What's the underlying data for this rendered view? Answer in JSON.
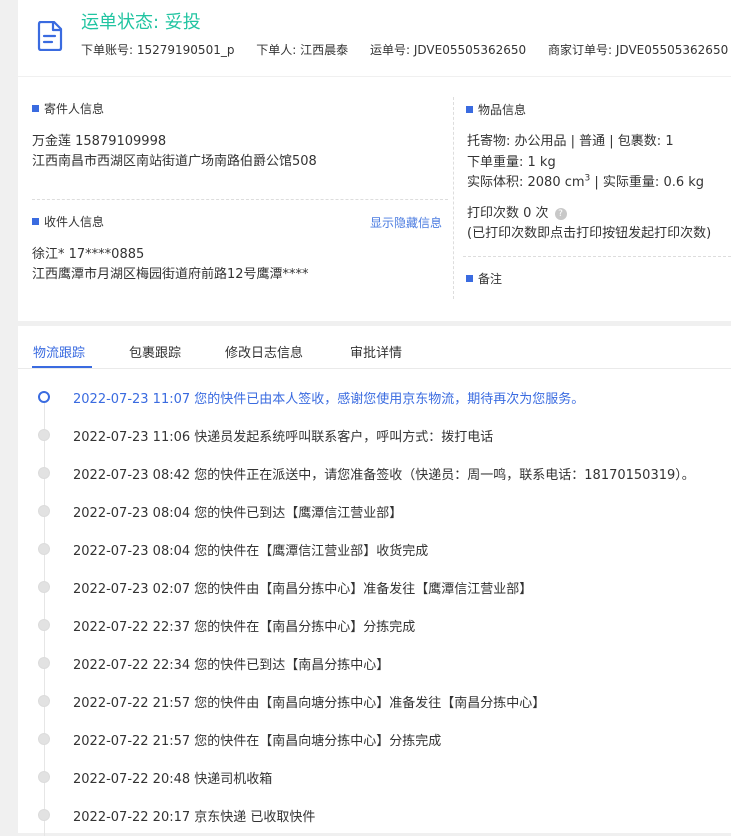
{
  "header": {
    "status": "运单状态: 妥投",
    "order_account": "下单账号: 15279190501_p",
    "orderer": "下单人: 江西晨泰",
    "waybill_no": "运单号: JDVE05505362650",
    "merchant_order_no": "商家订单号: JDVE05505362650",
    "status_color": "#21c4a1"
  },
  "sender": {
    "title": "寄件人信息",
    "name_phone": "万金莲   15879109998",
    "address": "江西南昌市西湖区南站街道广场南路伯爵公馆508"
  },
  "receiver": {
    "title": "收件人信息",
    "toggle_link": "显示隐藏信息",
    "name_phone": "徐江*   17****0885",
    "address": "江西鹰潭市月湖区梅园街道府前路12号鹰潭****"
  },
  "goods": {
    "title": "物品信息",
    "line1": "托寄物:  办公用品 | 普通  |  包裹数:  1",
    "line2": "下单重量:  1 kg",
    "volume_prefix": "实际体积:    2080 cm",
    "volume_sup": "3",
    "volume_suffix": "  |  实际重量:   0.6 kg",
    "print_count": "打印次数    0 次",
    "print_note": "(已打印次数即点击打印按钮发起打印次数)"
  },
  "remark": {
    "title": "备注"
  },
  "tabs": [
    "物流跟踪",
    "包裹跟踪",
    "修改日志信息",
    "审批详情"
  ],
  "timeline": [
    "2022-07-23 11:07 您的快件已由本人签收，感谢您使用京东物流，期待再次为您服务。",
    "2022-07-23 11:06 快递员发起系统呼叫联系客户，呼叫方式：拨打电话",
    "2022-07-23 08:42 您的快件正在派送中，请您准备签收（快递员：周一鸣，联系电话：18170150319）。",
    "2022-07-23 08:04 您的快件已到达【鹰潭信江营业部】",
    "2022-07-23 08:04 您的快件在【鹰潭信江营业部】收货完成",
    "2022-07-23 02:07 您的快件由【南昌分拣中心】准备发往【鹰潭信江营业部】",
    "2022-07-22 22:37 您的快件在【南昌分拣中心】分拣完成",
    "2022-07-22 22:34 您的快件已到达【南昌分拣中心】",
    "2022-07-22 21:57 您的快件由【南昌向塘分拣中心】准备发往【南昌分拣中心】",
    "2022-07-22 21:57 您的快件在【南昌向塘分拣中心】分拣完成",
    "2022-07-22 20:48 快递司机收箱",
    "2022-07-22 20:17 京东快递 已收取快件"
  ],
  "accent_color": "#3a6be0"
}
